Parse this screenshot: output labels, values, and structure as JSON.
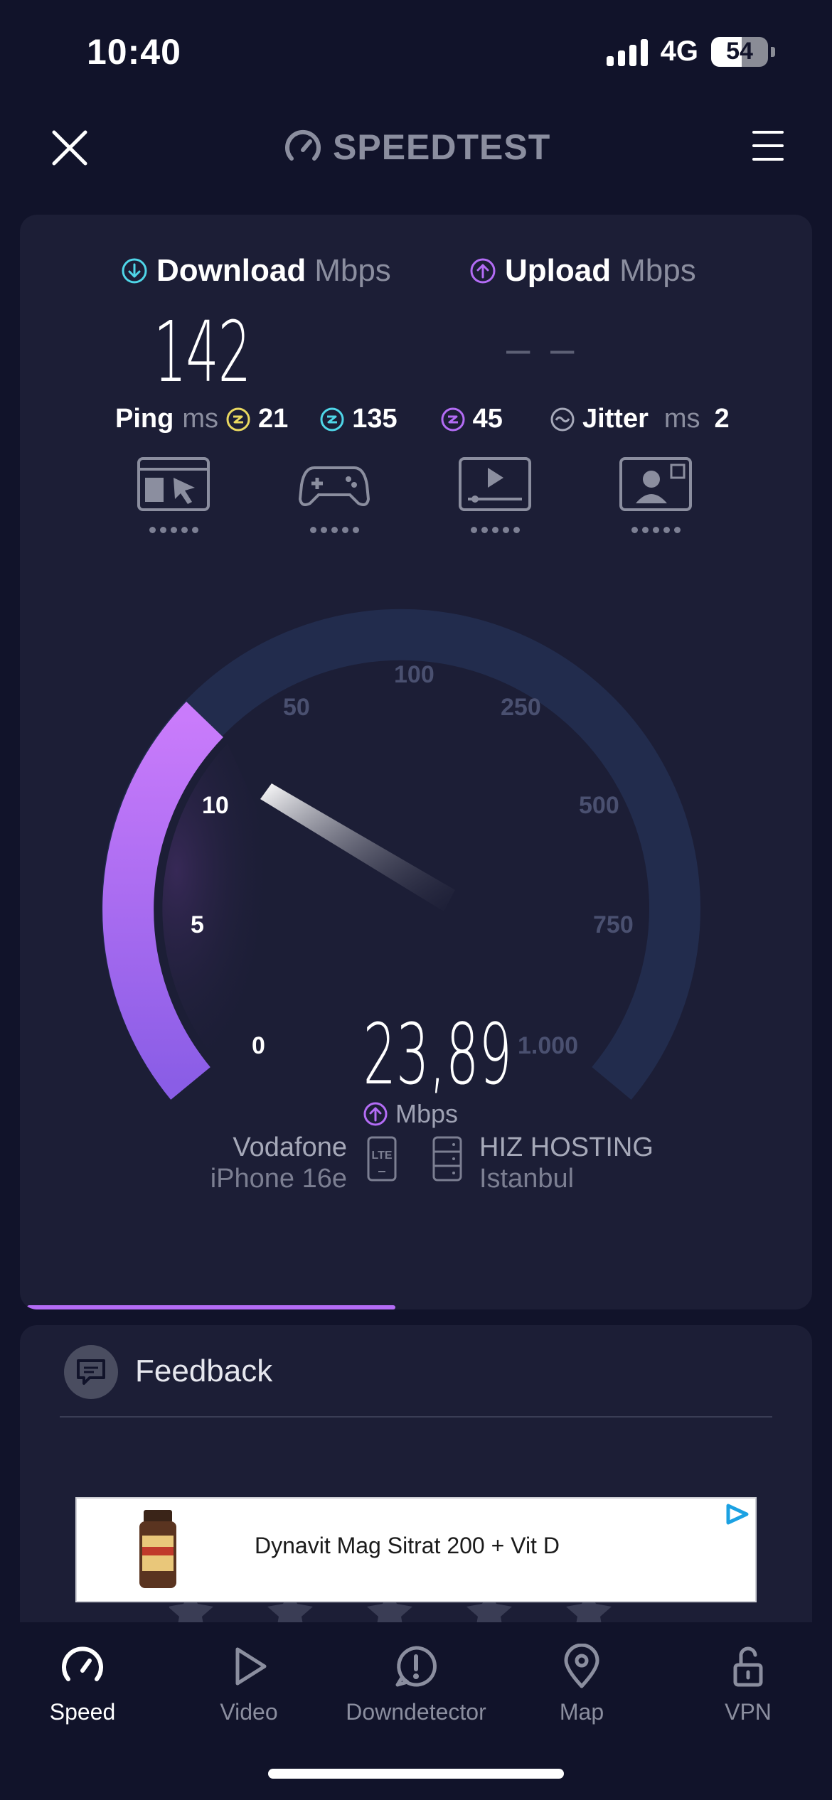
{
  "status_bar": {
    "time": "10:40",
    "network": "4G",
    "battery": "54"
  },
  "header": {
    "brand": "SPEEDTEST"
  },
  "results": {
    "download": {
      "label": "Download",
      "unit": "Mbps",
      "value": "142"
    },
    "upload": {
      "label": "Upload",
      "unit": "Mbps",
      "value": "– –"
    },
    "ping": {
      "label": "Ping",
      "unit": "ms",
      "idle": "21",
      "download": "135",
      "upload": "45"
    },
    "jitter": {
      "label": "Jitter",
      "unit": "ms",
      "value": "2"
    }
  },
  "quality_icons": [
    "browsing-icon",
    "gaming-icon",
    "video-streaming-icon",
    "video-call-icon"
  ],
  "gauge": {
    "ticks": [
      "0",
      "5",
      "10",
      "50",
      "100",
      "250",
      "500",
      "750",
      "1.000"
    ],
    "current_value": "23,89",
    "unit": "Mbps",
    "progress_fraction": 0.29
  },
  "connection": {
    "provider": "Vodafone",
    "device": "iPhone 16e",
    "tech": "LTE",
    "server": "HIZ HOSTING",
    "server_location": "Istanbul"
  },
  "test_progress": 0.47,
  "feedback": {
    "label": "Feedback"
  },
  "ad": {
    "text": "Dynavit Mag Sitrat 200 + Vit D"
  },
  "nav": {
    "items": [
      {
        "label": "Speed",
        "active": true
      },
      {
        "label": "Video",
        "active": false
      },
      {
        "label": "Downdetector",
        "active": false
      },
      {
        "label": "Map",
        "active": false
      },
      {
        "label": "VPN",
        "active": false
      }
    ]
  },
  "colors": {
    "background": "#11132a",
    "card": "#1c1e36",
    "download_accent": "#4fd6e8",
    "upload_accent": "#b36cf5",
    "idle_ping": "#e9d860",
    "gauge_track": "#222c4d"
  }
}
